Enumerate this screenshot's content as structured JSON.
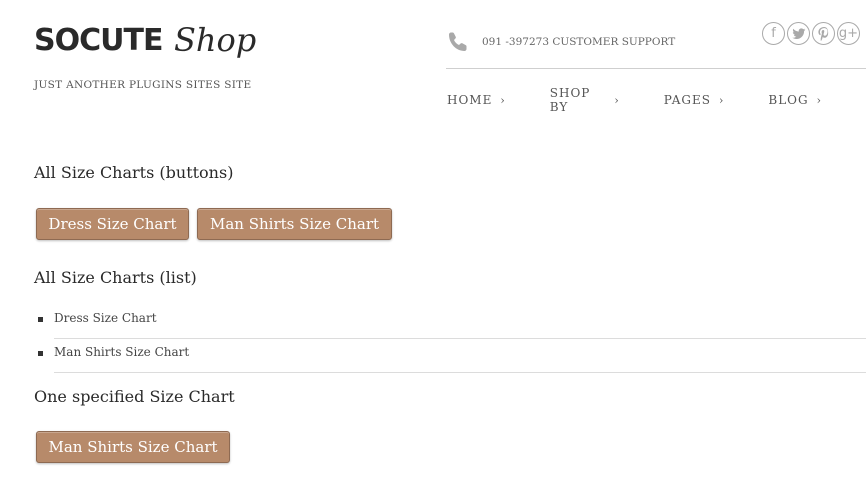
{
  "header": {
    "logo_main": "SOCUTE",
    "logo_script": "Shop",
    "tagline": "JUST ANOTHER PLUGINS SITES SITE",
    "support_text": "091 -397273 CUSTOMER SUPPORT",
    "social": [
      {
        "icon": "facebook-icon",
        "glyph": "f"
      },
      {
        "icon": "twitter-icon",
        "glyph": "t"
      },
      {
        "icon": "pinterest-icon",
        "glyph": "p"
      },
      {
        "icon": "google-plus-icon",
        "glyph": "g+"
      }
    ]
  },
  "nav": {
    "items": [
      {
        "label": "HOME"
      },
      {
        "label": "SHOP BY"
      },
      {
        "label": "PAGES"
      },
      {
        "label": "BLOG"
      }
    ]
  },
  "content": {
    "section_buttons_title": "All Size Charts (buttons)",
    "buttons": [
      {
        "label": "Dress Size Chart"
      },
      {
        "label": "Man Shirts Size Chart"
      }
    ],
    "section_list_title": "All Size Charts (list)",
    "list": [
      {
        "label": "Dress Size Chart"
      },
      {
        "label": "Man Shirts Size Chart"
      }
    ],
    "section_specified_title": "One specified Size Chart",
    "specified_button": {
      "label": "Man Shirts Size Chart"
    }
  },
  "colors": {
    "button_bg": "#b78a6a",
    "button_border": "#8e6a52",
    "text_dark": "#2a2a2a",
    "icon_gray": "#a9a9a9"
  }
}
